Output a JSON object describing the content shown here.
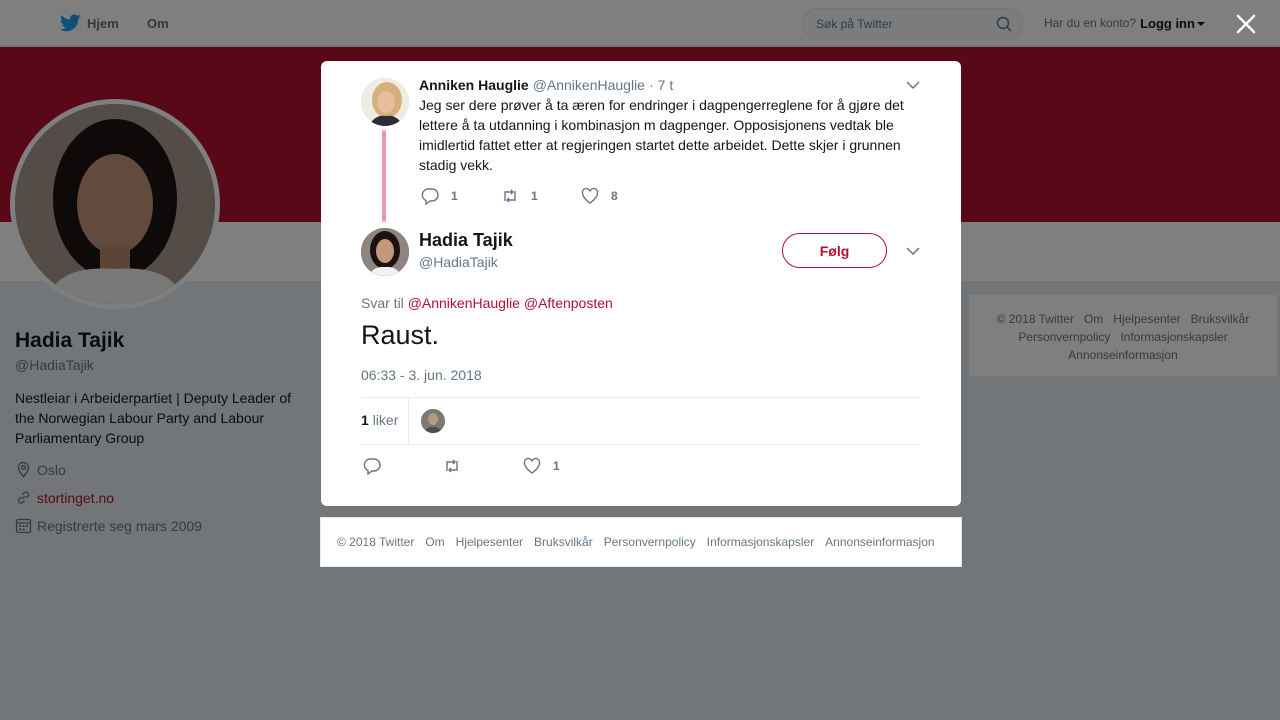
{
  "topbar": {
    "home_label": "Hjem",
    "about_label": "Om",
    "search_placeholder": "Søk på Twitter",
    "account_prompt": "Har du en konto?",
    "login_label": "Logg inn"
  },
  "profile": {
    "name": "Hadia Tajik",
    "handle": "@HadiaTajik",
    "bio": "Nestleiar i Arbeiderpartiet | Deputy Leader of the Norwegian Labour Party and Labour Parliamentary Group",
    "location": "Oslo",
    "website": "stortinget.no",
    "joined": "Registrerte seg mars 2009"
  },
  "side_footer": {
    "links": [
      "© 2018 Twitter",
      "Om",
      "Hjelpesenter",
      "Bruksvilkår",
      "Personvernpolicy",
      "Informasjonskapsler",
      "Annonseinformasjon"
    ]
  },
  "modal": {
    "parent_tweet": {
      "name": "Anniken Hauglie",
      "handle": "@AnnikenHauglie",
      "separator": "·",
      "time": "7 t",
      "text": "Jeg ser dere prøver å ta æren for endringer i dagpengerreglene for å gjøre det lettere å ta utdanning i kombinasjon m dagpenger. Opposisjonens vedtak ble imidlertid fattet etter at regjeringen startet dette arbeidet. Dette skjer i grunnen stadig vekk.",
      "replies": "1",
      "retweets": "1",
      "likes": "8"
    },
    "tweet": {
      "name": "Hadia Tajik",
      "handle": "@HadiaTajik",
      "follow_label": "Følg",
      "reply_prefix": "Svar til",
      "reply_mention_1": "@AnnikenHauglie",
      "reply_mention_2": "@Aftenposten",
      "text": "Raust.",
      "timestamp": "06:33 - 3. jun. 2018",
      "like_count": "1",
      "like_label": "liker",
      "likes_action_count": "1"
    },
    "footer_links": [
      "© 2018 Twitter",
      "Om",
      "Hjelpesenter",
      "Bruksvilkår",
      "Personvernpolicy",
      "Informasjonskapsler",
      "Annonseinformasjon"
    ]
  },
  "colors": {
    "accent": "#b2112f",
    "thread_line": "#e99aaf",
    "muted_text": "#657786"
  }
}
